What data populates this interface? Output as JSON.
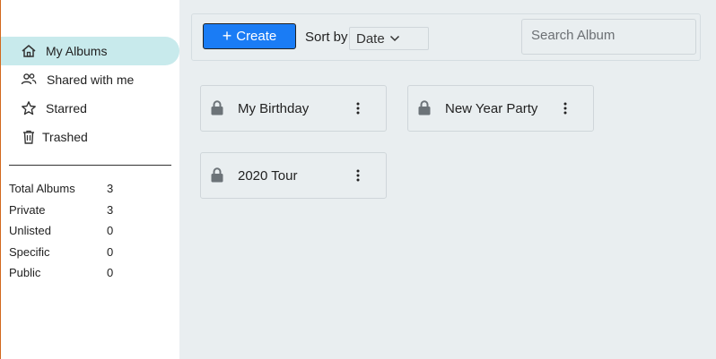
{
  "sidebar": {
    "items": [
      {
        "label": "My Albums",
        "icon": "home-icon",
        "active": true
      },
      {
        "label": "Shared with me",
        "icon": "users-icon",
        "active": false
      },
      {
        "label": "Starred",
        "icon": "star-icon",
        "active": false
      },
      {
        "label": "Trashed",
        "icon": "trash-icon",
        "active": false
      }
    ],
    "stats": [
      {
        "label": "Total Albums",
        "value": "3"
      },
      {
        "label": "Private",
        "value": "3"
      },
      {
        "label": "Unlisted",
        "value": "0"
      },
      {
        "label": "Specific",
        "value": "0"
      },
      {
        "label": "Public",
        "value": "0"
      }
    ]
  },
  "toolbar": {
    "create_label": "Create",
    "sort_label": "Sort by",
    "sort_value": "Date",
    "search_placeholder": "Search Album"
  },
  "albums": [
    {
      "name": "My Birthday",
      "icon": "lock-icon"
    },
    {
      "name": "New Year Party",
      "icon": "lock-icon"
    },
    {
      "name": "2020 Tour",
      "icon": "lock-icon"
    }
  ],
  "colors": {
    "accent": "#1a7cf5",
    "active_nav": "#c8eaec",
    "main_bg": "#e9eef0"
  }
}
